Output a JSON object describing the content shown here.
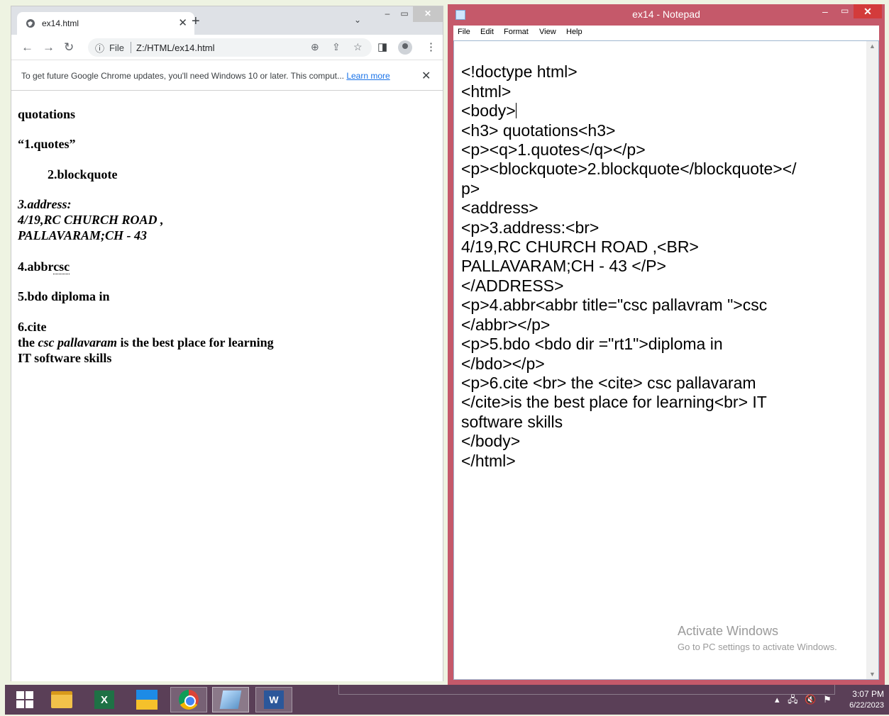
{
  "browser": {
    "tab_title": "ex14.html",
    "omnibox_scheme": "File",
    "url": "Z:/HTML/ex14.html",
    "infobar_message": "To get future Google Chrome updates, you'll need Windows 10 or later. This comput...",
    "infobar_link": "Learn more",
    "page": {
      "heading": "quotations",
      "quote": "“1.quotes”",
      "blockquote": "2.blockquote",
      "address_label": "3.address:",
      "address_line1": "4/19,RC CHURCH ROAD ,",
      "address_line2": "PALLAVARAM;CH - 43",
      "abbr_prefix": "4.abbr",
      "abbr_text": "csc",
      "bdo_line": "5.bdo diploma in",
      "cite_label": "6.cite",
      "cite_before": "the ",
      "cite_text": "csc pallavaram",
      "cite_after": " is the best place for learning",
      "cite_line2": "IT software skills"
    }
  },
  "notepad": {
    "title": "ex14 - Notepad",
    "menu": [
      "File",
      "Edit",
      "Format",
      "View",
      "Help"
    ],
    "lines": [
      "<!doctype html>",
      "<html>",
      "<body>",
      "<h3> quotations<h3>",
      "<p><q>1.quotes</q></p>",
      "<p><blockquote>2.blockquote</blockquote></",
      "p>",
      "<address>",
      "<p>3.address:<br>",
      "4/19,RC CHURCH ROAD ,<BR>",
      "PALLAVARAM;CH - 43 </P>",
      "</ADDRESS>",
      "<p>4.abbr<abbr title=\"csc pallavram \">csc",
      "</abbr></p>",
      "<p>5.bdo <bdo dir =\"rt1\">diploma in",
      "</bdo></p>",
      "<p>6.cite <br> the <cite> csc pallavaram",
      "</cite>is the best place for learning<br> IT",
      "software skills",
      "</body>",
      "</html>"
    ]
  },
  "watermark": {
    "title": "Activate Windows",
    "subtitle": "Go to PC settings to activate Windows."
  },
  "taskbar": {
    "time": "3:07 PM",
    "date": "6/22/2023"
  }
}
